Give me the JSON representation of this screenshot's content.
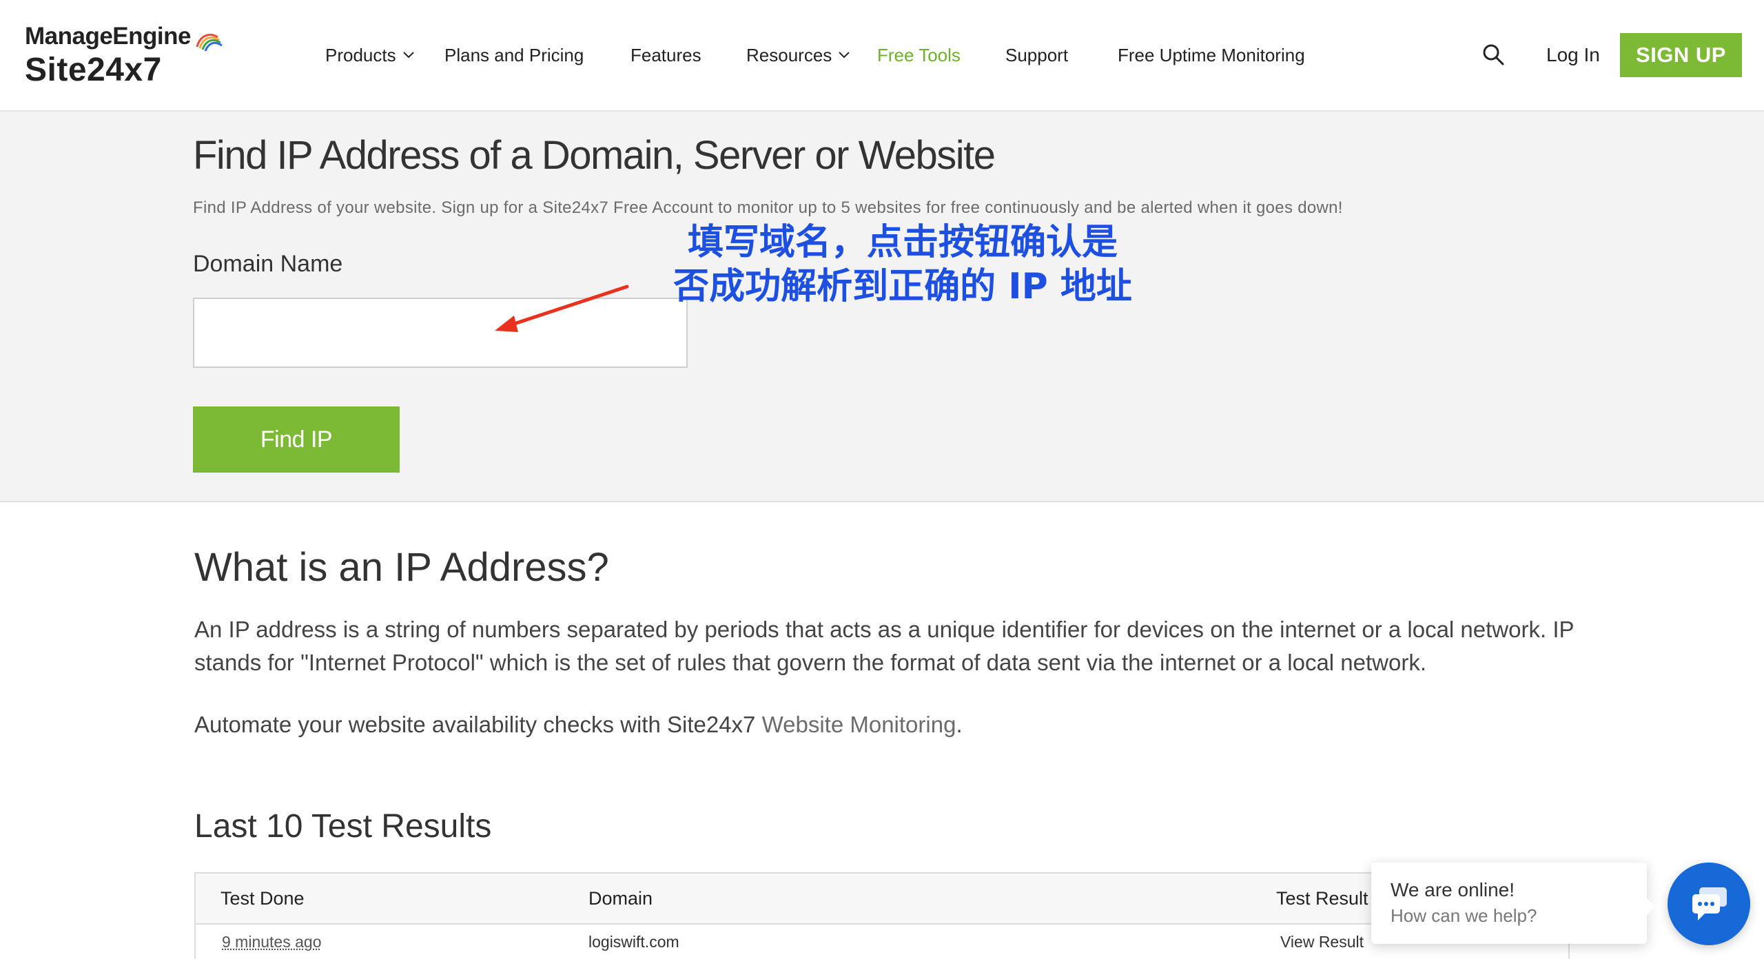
{
  "header": {
    "brand": "ManageEngine",
    "product": "Site24x7",
    "nav": [
      {
        "label": "Products",
        "has_dropdown": true
      },
      {
        "label": "Plans and Pricing",
        "has_dropdown": false
      },
      {
        "label": "Features",
        "has_dropdown": false
      },
      {
        "label": "Resources",
        "has_dropdown": true
      },
      {
        "label": "Free Tools",
        "has_dropdown": false,
        "active": true
      },
      {
        "label": "Support",
        "has_dropdown": false
      },
      {
        "label": "Free Uptime Monitoring",
        "has_dropdown": false
      }
    ],
    "search_icon": "search-icon",
    "login_label": "Log In",
    "signup_label": "SIGN UP"
  },
  "hero": {
    "title": "Find IP Address of a Domain, Server or Website",
    "subtitle": "Find IP Address of your website. Sign up for a Site24x7 Free Account to monitor up to 5 websites for free continuously and be alerted when it goes down!",
    "field_label": "Domain Name",
    "input_value": "",
    "button_label": "Find IP",
    "annotation_line1": "填写域名，点击按钮确认是",
    "annotation_line2": "否成功解析到正确的 IP 地址"
  },
  "about": {
    "heading": "What is an IP Address?",
    "paragraph1": "An IP address is a string of numbers separated by periods that acts as a unique identifier for devices on the internet or a local network. IP stands for \"Internet Protocol\" which is the set of rules that govern the format of data sent via the internet or a local network.",
    "paragraph2_prefix": "Automate your website availability checks with Site24x7 ",
    "paragraph2_link": "Website Monitoring",
    "paragraph2_suffix": "."
  },
  "results": {
    "heading": "Last 10 Test Results",
    "columns": [
      "Test Done",
      "Domain",
      "Test Result"
    ],
    "rows": [
      {
        "time": "9 minutes ago",
        "domain": "logiswift.com",
        "result": "View Result"
      }
    ]
  },
  "chat": {
    "title": "We are online!",
    "subtitle": "How can we help?",
    "launcher_icon": "chat-icon"
  },
  "colors": {
    "accent_green": "#7cb934",
    "active_nav": "#6fb22a",
    "annotation_blue": "#1d4fe0",
    "arrow_red": "#e8321e",
    "chat_blue": "#1669d6"
  }
}
